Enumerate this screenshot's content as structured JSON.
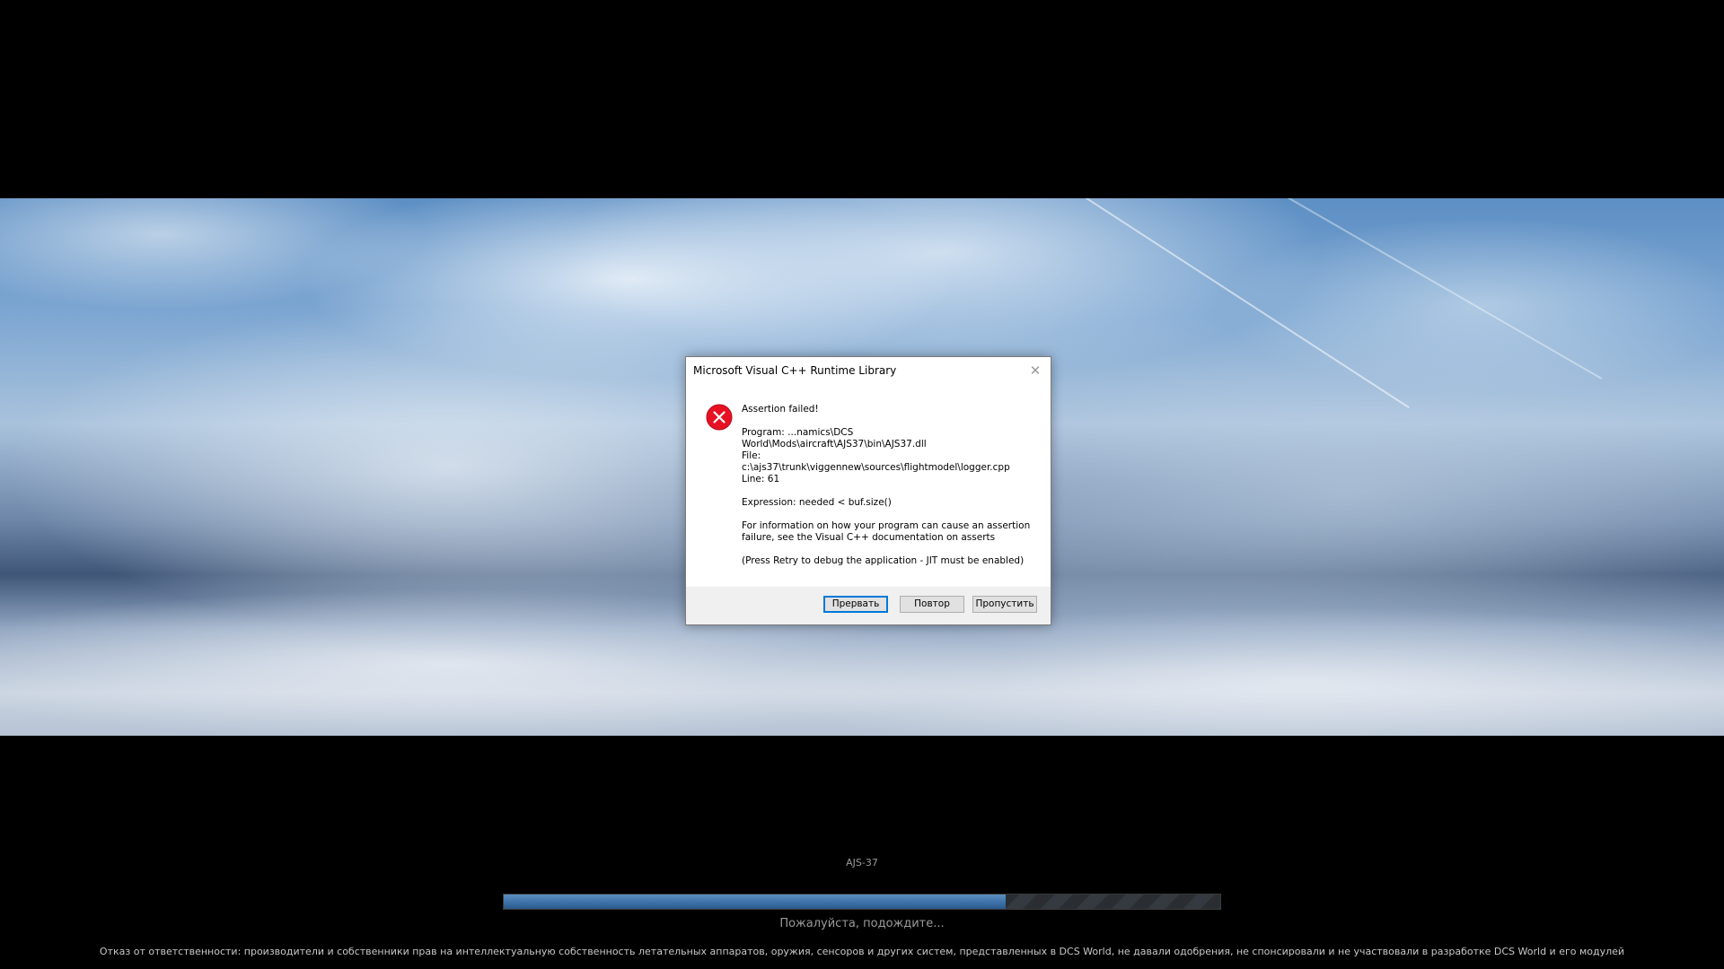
{
  "dialog": {
    "title": "Microsoft Visual C++ Runtime Library",
    "close_glyph": "✕",
    "lines": {
      "l1": "Assertion failed!",
      "l2": "Program: ...namics\\DCS",
      "l3": "World\\Mods\\aircraft\\AJS37\\bin\\AJS37.dll",
      "l4": "File:",
      "l5": "c:\\ajs37\\trunk\\viggennew\\sources\\flightmodel\\logger.cpp",
      "l6": "Line: 61",
      "l7": "Expression: needed < buf.size()",
      "l8": "For information on how your program can cause an assertion",
      "l9": "failure, see the Visual C++ documentation on asserts",
      "l10": "(Press Retry to debug the application - JIT must be enabled)"
    },
    "buttons": {
      "abort": "Прервать",
      "retry": "Повтор",
      "ignore": "Пропустить"
    },
    "icon": "error-icon",
    "icon_color": "#e81123"
  },
  "loading": {
    "module_name": "AJS-37",
    "progress_percent": 70,
    "wait_text": "Пожалуйста, подождите...",
    "progress_color": "#3f74ab"
  },
  "disclaimer": "Отказ от ответственности: производители и собственники прав на интеллектуальную собственность летательных аппаратов, оружия, сенсоров и других систем, представленных в DCS World, не давали одобрения, не спонсировали и не участвовали в разработке DCS World и его модулей"
}
